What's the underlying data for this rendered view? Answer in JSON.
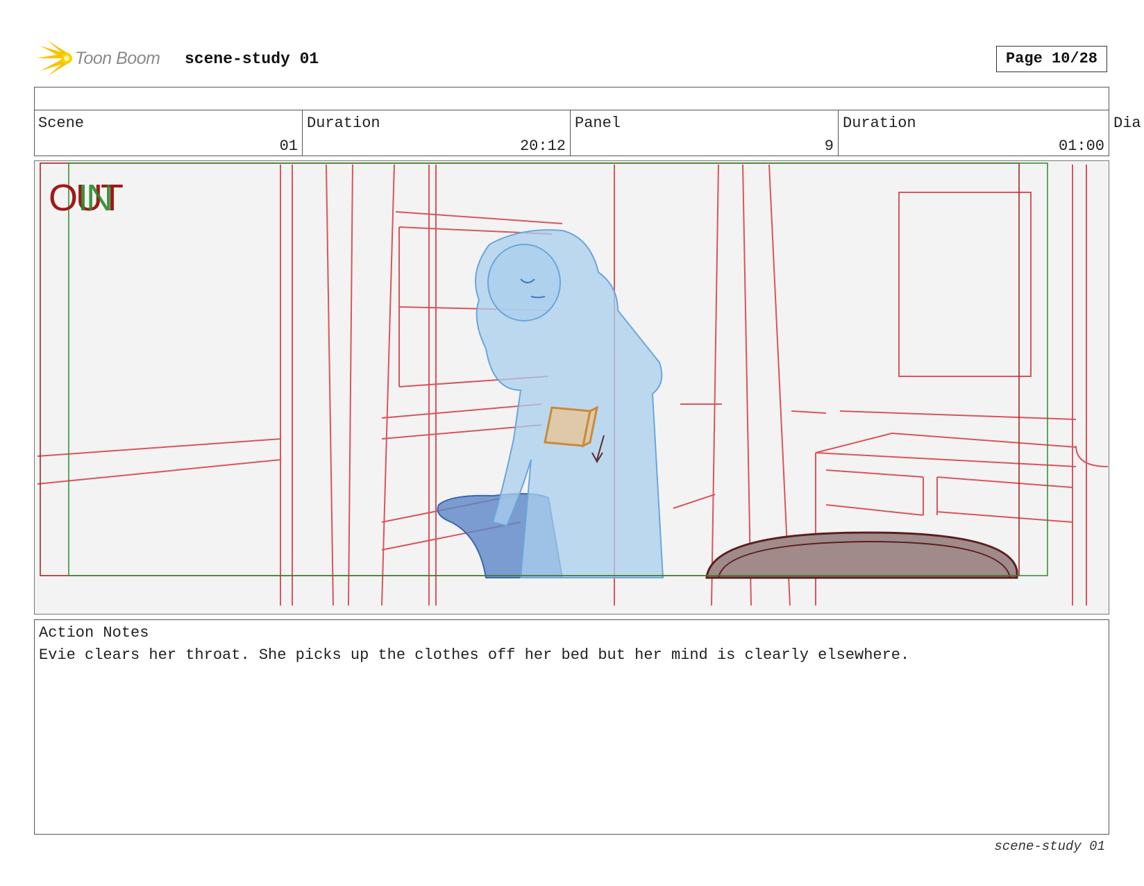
{
  "header": {
    "logo_text": "Toon Boom",
    "project_title": "scene-study 01",
    "page_label": "Page 10/28"
  },
  "info": {
    "scene_label": "Scene",
    "scene_value": "01",
    "scene_duration_label": "Duration",
    "scene_duration_value": "20:12",
    "panel_label": "Panel",
    "panel_value": "9",
    "panel_duration_label": "Duration",
    "panel_duration_value": "01:00",
    "dialog_label_partial": "Dia"
  },
  "panel_image": {
    "out_marker": "OUT",
    "in_marker": "IN",
    "colors": {
      "layout": "#d9545a",
      "character": "#7fb5e0",
      "prop_blue": "#5b86c7",
      "book": "#c98a3a",
      "table": "#a08080",
      "frame_out": "#a01818",
      "frame_in": "#2a8a2a"
    }
  },
  "notes": {
    "label": "Action Notes",
    "text": "Evie clears her throat. She picks up the clothes off her bed but her mind is clearly elsewhere."
  },
  "footer": {
    "text": "scene-study 01"
  }
}
